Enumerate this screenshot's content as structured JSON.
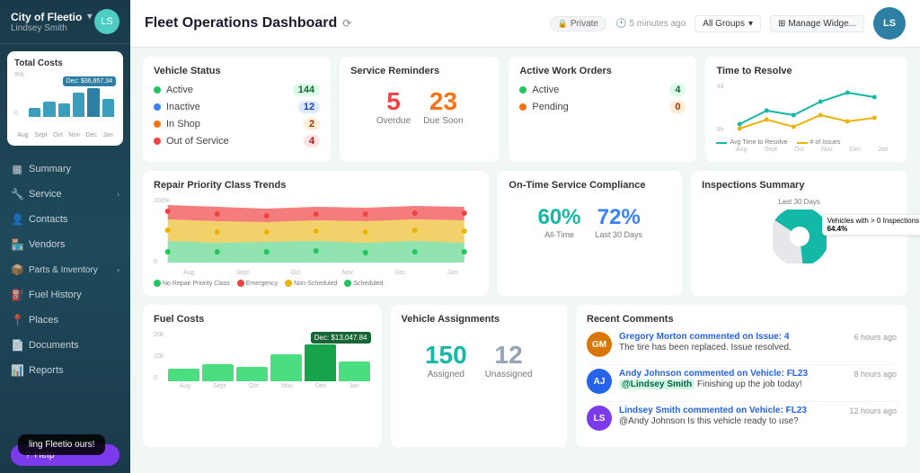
{
  "sidebar": {
    "org_name": "City of Fleetio",
    "user_name": "Lindsey Smith",
    "total_costs_title": "Total Costs",
    "chart": {
      "tooltip": "Dec: $36,857.34",
      "y_max": "80k",
      "y_min": "0",
      "months": [
        "Aug",
        "Sept",
        "Oct",
        "Nov",
        "Dec",
        "Jan"
      ],
      "bars": [
        20,
        35,
        30,
        55,
        65,
        40
      ]
    },
    "nav_items": [
      {
        "label": "Summary",
        "icon": "▦"
      },
      {
        "label": "Service ›",
        "icon": "🔧"
      },
      {
        "label": "Contacts",
        "icon": "👤"
      },
      {
        "label": "Vendors",
        "icon": "🏪"
      },
      {
        "label": "Parts & Inventory ›",
        "icon": "📦"
      },
      {
        "label": "Fuel History",
        "icon": "⛽"
      },
      {
        "label": "Places",
        "icon": "📍"
      },
      {
        "label": "Documents",
        "icon": "📄"
      },
      {
        "label": "Reports",
        "icon": "📊"
      }
    ],
    "help_label": "Help"
  },
  "topbar": {
    "title": "Fleet Operations Dashboard",
    "private_label": "Private",
    "time_ago": "5 minutes ago",
    "groups_label": "All Groups",
    "manage_label": "Manage Widge..."
  },
  "vehicle_status": {
    "title": "Vehicle Status",
    "items": [
      {
        "label": "Active",
        "count": "144",
        "color": "green"
      },
      {
        "label": "Inactive",
        "count": "12",
        "color": "blue"
      },
      {
        "label": "In Shop",
        "count": "2",
        "color": "orange"
      },
      {
        "label": "Out of Service",
        "count": "4",
        "color": "red"
      }
    ]
  },
  "service_reminders": {
    "title": "Service Reminders",
    "overdue_count": "5",
    "overdue_label": "Overdue",
    "due_soon_count": "23",
    "due_soon_label": "Due Soon"
  },
  "active_work_orders": {
    "title": "Active Work Orders",
    "items": [
      {
        "label": "Active",
        "count": "4",
        "color": "green"
      },
      {
        "label": "Pending",
        "count": "0",
        "color": "orange"
      }
    ]
  },
  "time_to_resolve": {
    "title": "Time to Resolve",
    "y_max": "4d",
    "y_min": "0h",
    "months": [
      "Aug",
      "Sept",
      "Oct",
      "Nov",
      "Dec",
      "Jan"
    ],
    "legend_avg": "Avg Time to Resolve",
    "legend_issues": "# of Issues"
  },
  "repair_trends": {
    "title": "Repair Priority Class Trends",
    "y_max": "100%",
    "y_min": "0",
    "months": [
      "Aug",
      "Sept",
      "Oct",
      "Nov",
      "Dec",
      "Jan"
    ],
    "legend": [
      {
        "label": "No Repair Priority Class",
        "color": "#22c55e"
      },
      {
        "label": "Emergency",
        "color": "#ef4444"
      },
      {
        "label": "Non-Scheduled",
        "color": "#eab308"
      },
      {
        "label": "Scheduled",
        "color": "#22c55e"
      }
    ]
  },
  "compliance": {
    "title": "On-Time Service Compliance",
    "all_time_pct": "60%",
    "all_time_label": "All-Time",
    "last30_pct": "72%",
    "last30_label": "Last 30 Days"
  },
  "inspections": {
    "title": "Inspections Summary",
    "subtitle": "Last 30 Days",
    "tooltip_text": "Vehicles with > 0 Inspections",
    "tooltip_pct": "64.4%",
    "chart_data": [
      64,
      36
    ]
  },
  "fuel_costs": {
    "title": "Fuel Costs",
    "tooltip": "Dec: $13,047.84",
    "y_labels": [
      "20k",
      "10k",
      "0"
    ],
    "months": [
      "Aug",
      "Sept",
      "Oct",
      "Nov",
      "Dec",
      "Jan"
    ],
    "bars": [
      25,
      35,
      30,
      55,
      70,
      40
    ]
  },
  "vehicle_assignments": {
    "title": "Vehicle Assignments",
    "assigned_count": "150",
    "assigned_label": "Assigned",
    "unassigned_count": "12",
    "unassigned_label": "Unassigned"
  },
  "recent_comments": {
    "title": "Recent Comments",
    "comments": [
      {
        "author": "Gregory Morton",
        "action": "commented on Issue: 4",
        "time_ago": "6 hours ago",
        "text": "The tire has been replaced. Issue resolved.",
        "avatar_color": "#d97706"
      },
      {
        "author": "Andy Johnson",
        "action": "commented on Vehicle: FL23",
        "time_ago": "8 hours ago",
        "mention": "@Lindsey Smith",
        "text": "Finishing up the job today!",
        "avatar_color": "#2563eb"
      },
      {
        "author": "Lindsey Smith",
        "action": "commented on Vehicle: FL23",
        "time_ago": "12 hours ago",
        "text": "@Andy Johnson  Is this vehicle ready to use?",
        "avatar_color": "#7c3aed"
      }
    ]
  },
  "toast": {
    "text": "ling Fleetio ours!"
  }
}
